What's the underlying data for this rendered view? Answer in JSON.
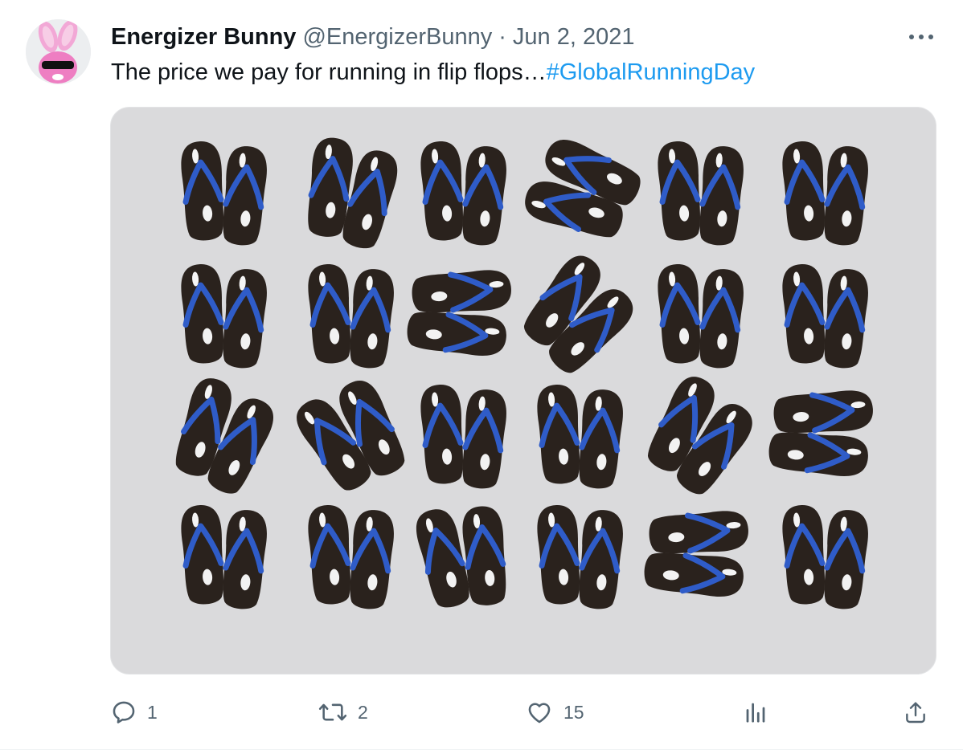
{
  "author": {
    "name": "Energizer Bunny",
    "handle": "@EnergizerBunny",
    "separator": "·",
    "date": "Jun 2, 2021",
    "avatar_icon": "pink-bunny-sunglasses-avatar"
  },
  "tweet": {
    "text": "The price we pay for running in flip flops…",
    "hashtag": "#GlobalRunningDay",
    "hashtag_color": "#1d9bf0"
  },
  "media": {
    "icon": "flip-flops-grid-image",
    "background": "#dadadc",
    "sole_color": "#2a221d",
    "strap_color": "#2f5cc8"
  },
  "actions": {
    "reply": {
      "icon": "reply-icon",
      "count": "1"
    },
    "retweet": {
      "icon": "retweet-icon",
      "count": "2"
    },
    "like": {
      "icon": "heart-icon",
      "count": "15"
    },
    "views": {
      "icon": "analytics-icon"
    },
    "share": {
      "icon": "share-icon"
    }
  },
  "more_menu": {
    "icon": "more-options-icon"
  }
}
